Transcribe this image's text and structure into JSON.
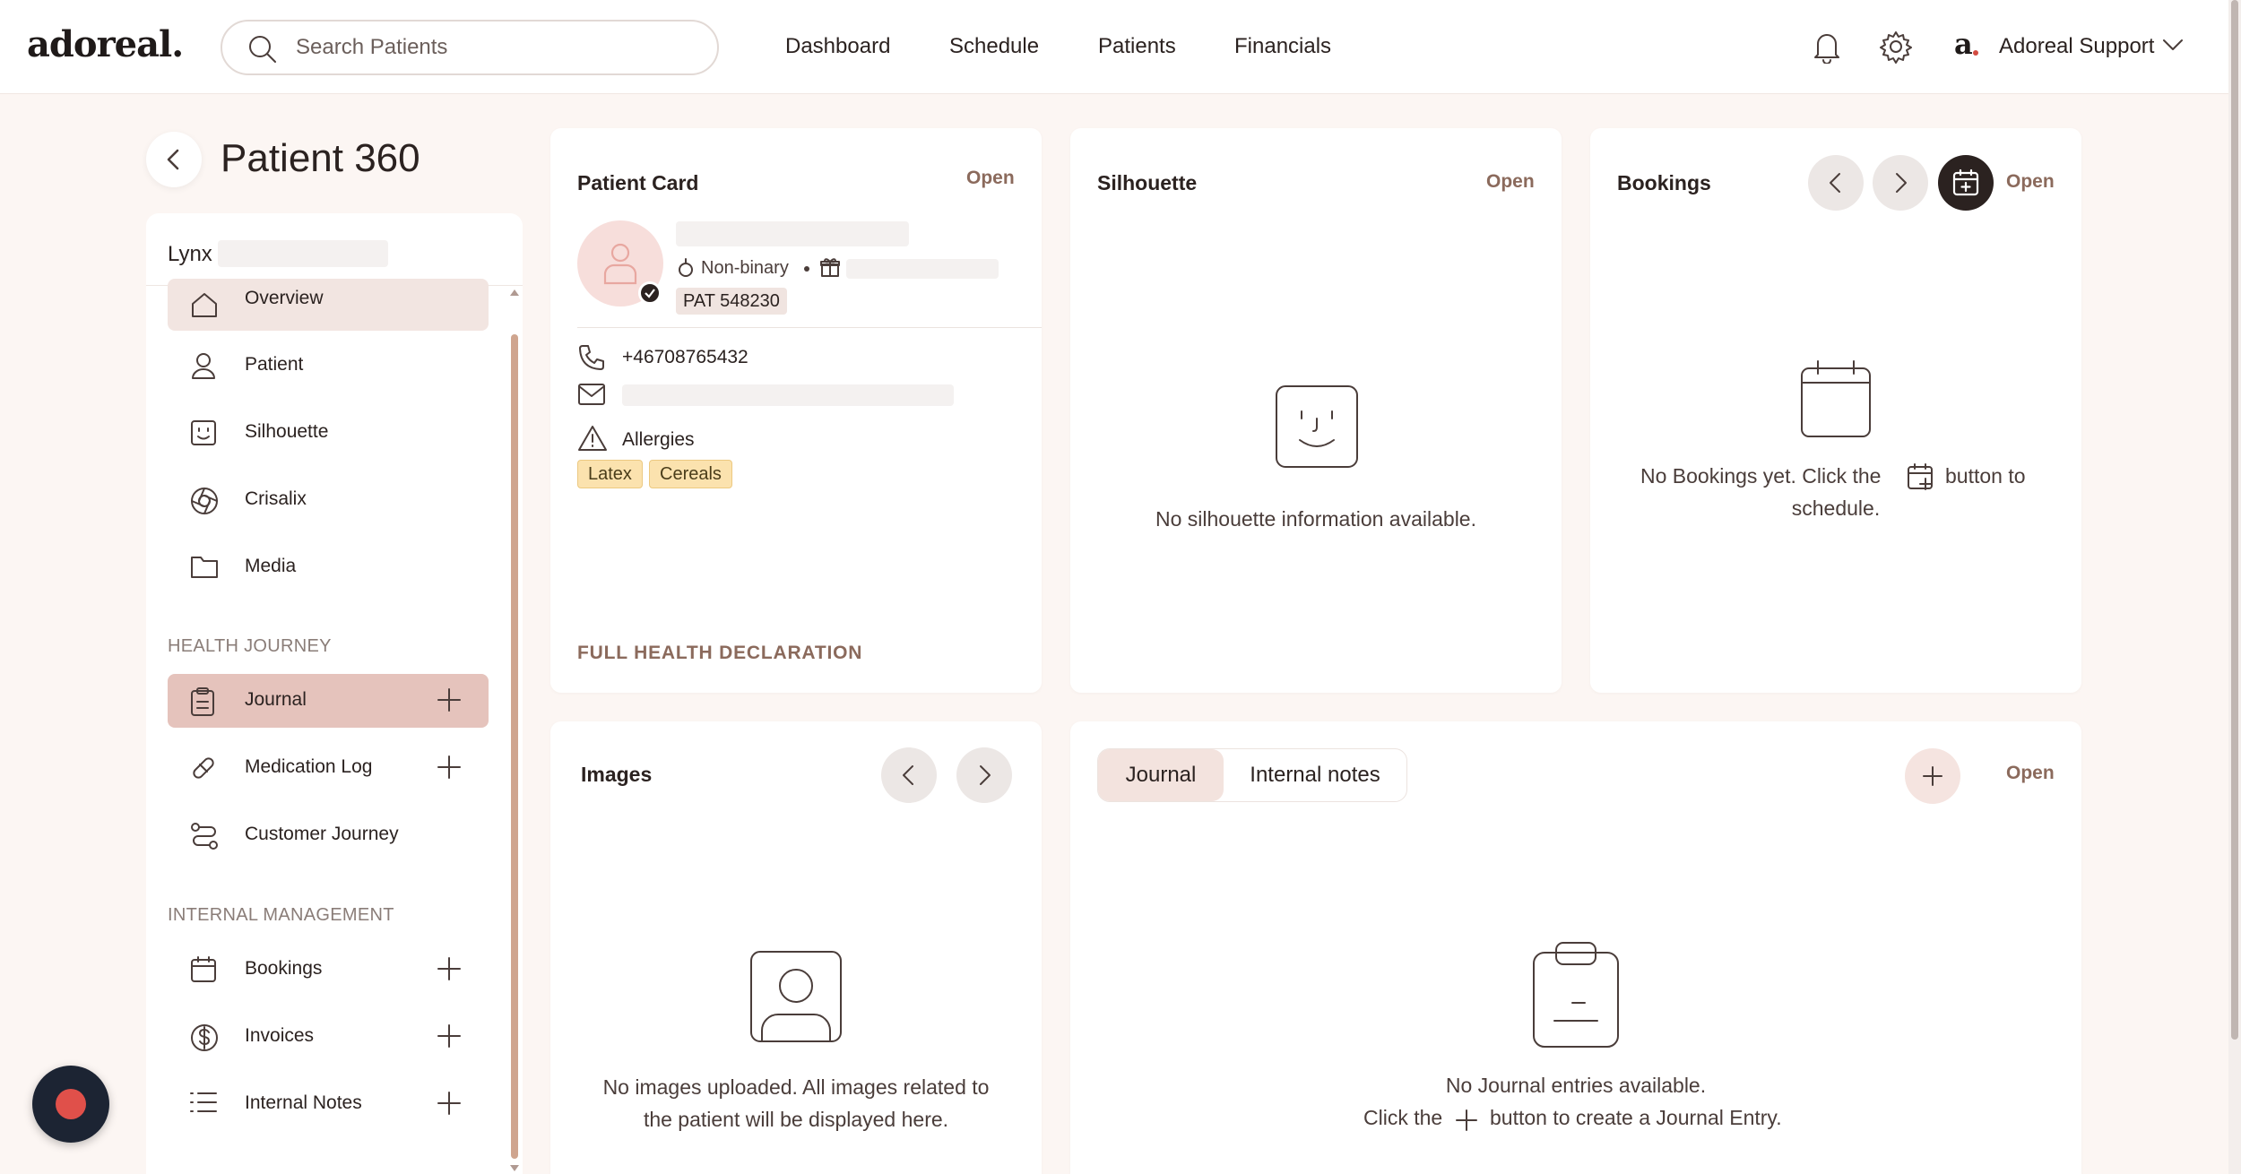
{
  "app": {
    "logo": "adoreal.",
    "search_placeholder": "Search Patients",
    "nav": [
      "Dashboard",
      "Schedule",
      "Patients",
      "Financials"
    ],
    "user": {
      "logo_letter": "a",
      "name": "Adoreal Support"
    }
  },
  "page": {
    "title": "Patient 360"
  },
  "sidebar": {
    "patient_name": "Lynx",
    "items": [
      {
        "label": "Overview",
        "icon": "home-icon"
      },
      {
        "label": "Patient",
        "icon": "person-icon"
      },
      {
        "label": "Silhouette",
        "icon": "face-icon"
      },
      {
        "label": "Crisalix",
        "icon": "aperture-icon"
      },
      {
        "label": "Media",
        "icon": "folder-icon"
      }
    ],
    "health_journey": {
      "title": "HEALTH JOURNEY",
      "items": [
        {
          "label": "Journal",
          "icon": "clipboard-icon"
        },
        {
          "label": "Medication Log",
          "icon": "pill-icon"
        },
        {
          "label": "Customer Journey",
          "icon": "route-icon"
        }
      ]
    },
    "internal_management": {
      "title": "INTERNAL MANAGEMENT",
      "items": [
        {
          "label": "Bookings",
          "icon": "calendar-icon"
        },
        {
          "label": "Invoices",
          "icon": "dollar-icon"
        },
        {
          "label": "Internal Notes",
          "icon": "list-icon"
        }
      ]
    }
  },
  "patient_card": {
    "title": "Patient Card",
    "open": "Open",
    "gender": "Non-binary",
    "patient_id": "PAT 548230",
    "phone": "+46708765432",
    "allergies_label": "Allergies",
    "allergies": [
      "Latex",
      "Cereals"
    ],
    "health_declaration": "FULL HEALTH DECLARATION"
  },
  "silhouette": {
    "title": "Silhouette",
    "open": "Open",
    "empty": "No silhouette information available."
  },
  "bookings": {
    "title": "Bookings",
    "open": "Open",
    "empty_before": "No Bookings yet. Click the",
    "empty_after": "button to",
    "empty_line2": "schedule."
  },
  "images": {
    "title": "Images",
    "empty_line1": "No images uploaded. All images related to",
    "empty_line2": "the patient will be displayed here."
  },
  "journal_panel": {
    "tabs": [
      "Journal",
      "Internal notes"
    ],
    "open": "Open",
    "empty_line1": "No Journal entries available.",
    "empty_before": "Click the",
    "empty_after": "button to create a Journal Entry."
  },
  "colors": {
    "background": "#fcf6f3",
    "accent": "#8b6a5c",
    "active_item": "#e5c3bc",
    "allergy_chip": "#fbe2ae"
  }
}
